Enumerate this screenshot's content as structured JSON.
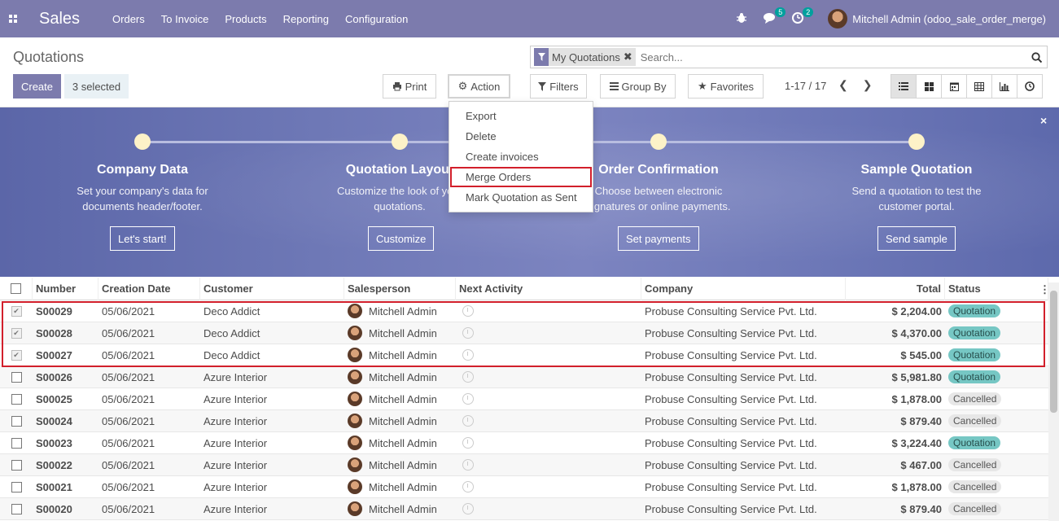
{
  "navbar": {
    "brand": "Sales",
    "menu": [
      "Orders",
      "To Invoice",
      "Products",
      "Reporting",
      "Configuration"
    ],
    "messages_count": "5",
    "activities_count": "2",
    "user": "Mitchell Admin (odoo_sale_order_merge)"
  },
  "control_panel": {
    "title": "Quotations",
    "create_label": "Create",
    "selected_label": "3 selected",
    "print_label": "Print",
    "action_label": "Action",
    "filters_label": "Filters",
    "groupby_label": "Group By",
    "favorites_label": "Favorites",
    "search_facet": "My Quotations",
    "search_placeholder": "Search...",
    "pager": "1-17 / 17"
  },
  "action_menu": [
    "Export",
    "Delete",
    "Create invoices",
    "Merge Orders",
    "Mark Quotation as Sent"
  ],
  "banner": {
    "steps": [
      {
        "title": "Company Data",
        "desc1": "Set your company's data for",
        "desc2": "documents header/footer.",
        "button": "Let's start!"
      },
      {
        "title": "Quotation Layout",
        "desc1": "Customize the look of your",
        "desc2": "quotations.",
        "button": "Customize"
      },
      {
        "title": "Order Confirmation",
        "desc1": "Choose between electronic",
        "desc2": "signatures or online payments.",
        "button": "Set payments"
      },
      {
        "title": "Sample Quotation",
        "desc1": "Send a quotation to test the",
        "desc2": "customer portal.",
        "button": "Send sample"
      }
    ],
    "close": "×"
  },
  "table": {
    "headers": [
      "Number",
      "Creation Date",
      "Customer",
      "Salesperson",
      "Next Activity",
      "Company",
      "Total",
      "Status"
    ],
    "rows": [
      {
        "number": "S00029",
        "date": "05/06/2021",
        "customer": "Deco Addict",
        "salesperson": "Mitchell Admin",
        "company": "Probuse Consulting Service Pvt. Ltd.",
        "total": "$ 2,204.00",
        "status": "Quotation",
        "checked": true
      },
      {
        "number": "S00028",
        "date": "05/06/2021",
        "customer": "Deco Addict",
        "salesperson": "Mitchell Admin",
        "company": "Probuse Consulting Service Pvt. Ltd.",
        "total": "$ 4,370.00",
        "status": "Quotation",
        "checked": true
      },
      {
        "number": "S00027",
        "date": "05/06/2021",
        "customer": "Deco Addict",
        "salesperson": "Mitchell Admin",
        "company": "Probuse Consulting Service Pvt. Ltd.",
        "total": "$ 545.00",
        "status": "Quotation",
        "checked": true
      },
      {
        "number": "S00026",
        "date": "05/06/2021",
        "customer": "Azure Interior",
        "salesperson": "Mitchell Admin",
        "company": "Probuse Consulting Service Pvt. Ltd.",
        "total": "$ 5,981.80",
        "status": "Quotation",
        "checked": false
      },
      {
        "number": "S00025",
        "date": "05/06/2021",
        "customer": "Azure Interior",
        "salesperson": "Mitchell Admin",
        "company": "Probuse Consulting Service Pvt. Ltd.",
        "total": "$ 1,878.00",
        "status": "Cancelled",
        "checked": false
      },
      {
        "number": "S00024",
        "date": "05/06/2021",
        "customer": "Azure Interior",
        "salesperson": "Mitchell Admin",
        "company": "Probuse Consulting Service Pvt. Ltd.",
        "total": "$ 879.40",
        "status": "Cancelled",
        "checked": false
      },
      {
        "number": "S00023",
        "date": "05/06/2021",
        "customer": "Azure Interior",
        "salesperson": "Mitchell Admin",
        "company": "Probuse Consulting Service Pvt. Ltd.",
        "total": "$ 3,224.40",
        "status": "Quotation",
        "checked": false
      },
      {
        "number": "S00022",
        "date": "05/06/2021",
        "customer": "Azure Interior",
        "salesperson": "Mitchell Admin",
        "company": "Probuse Consulting Service Pvt. Ltd.",
        "total": "$ 467.00",
        "status": "Cancelled",
        "checked": false
      },
      {
        "number": "S00021",
        "date": "05/06/2021",
        "customer": "Azure Interior",
        "salesperson": "Mitchell Admin",
        "company": "Probuse Consulting Service Pvt. Ltd.",
        "total": "$ 1,878.00",
        "status": "Cancelled",
        "checked": false
      },
      {
        "number": "S00020",
        "date": "05/06/2021",
        "customer": "Azure Interior",
        "salesperson": "Mitchell Admin",
        "company": "Probuse Consulting Service Pvt. Ltd.",
        "total": "$ 879.40",
        "status": "Cancelled",
        "checked": false
      }
    ]
  },
  "colors": {
    "brand": "#7c7bad",
    "quotation_badge": "#76c7c4",
    "highlight": "#d21f2b"
  }
}
